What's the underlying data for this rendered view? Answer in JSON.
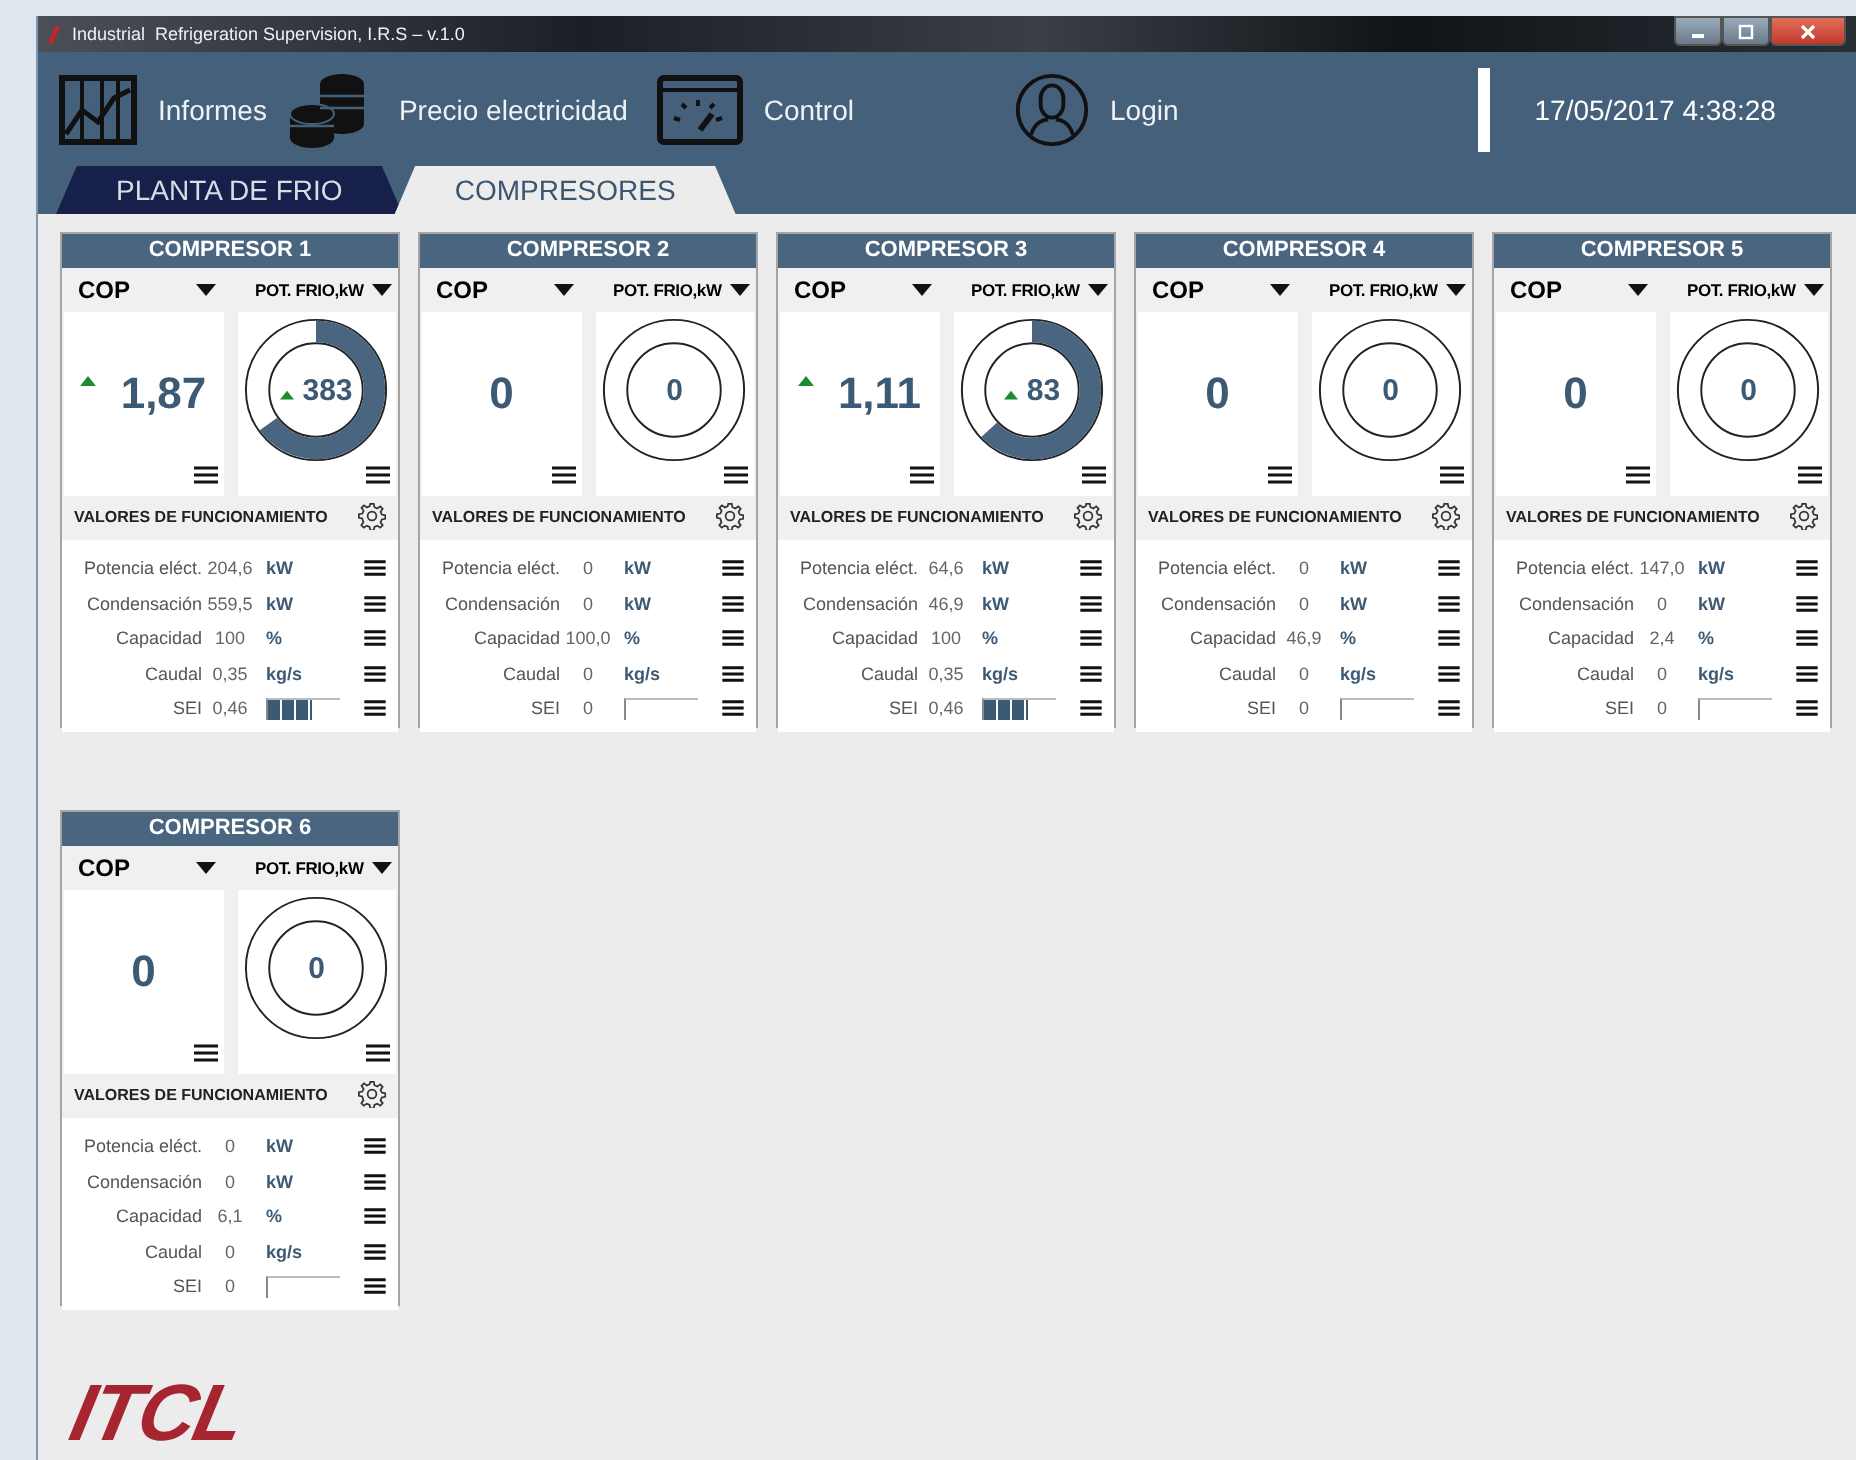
{
  "window": {
    "title": "Industrial  Refrigeration Supervision, I.R.S – v.1.0"
  },
  "toolbar": [
    {
      "label": "Informes",
      "kind": "chart"
    },
    {
      "label": "Precio electricidad",
      "kind": "coins"
    },
    {
      "label": "Control",
      "kind": "gauge"
    }
  ],
  "login": {
    "label": "Login"
  },
  "datetime": "17/05/2017 4:38:28",
  "tabs": [
    {
      "label": "PLANTA DE FRIO",
      "selected": false
    },
    {
      "label": "COMPRESORES",
      "selected": true
    }
  ],
  "compressors": [
    {
      "title": "COMPRESOR 1",
      "cop_label": "COP",
      "pot_label": "POT. FRIO,kW",
      "cop": "1,87",
      "cop_up": true,
      "pot": "383",
      "pot_up": true,
      "level": 0.65,
      "section": "VALORES DE FUNCIONAMIENTO",
      "rows": [
        {
          "kind": "value",
          "label": "Potencia eléct.",
          "value": "204,6",
          "unit": "kW"
        },
        {
          "kind": "value",
          "label": "Condensación",
          "value": "559,5",
          "unit": "kW"
        },
        {
          "kind": "value",
          "label": "Capacidad",
          "value": "100",
          "unit": "%"
        },
        {
          "kind": "value",
          "label": "Caudal",
          "value": "0,35",
          "unit": "kg/s"
        },
        {
          "kind": "bar",
          "label": "SEI",
          "value": "0,46",
          "level": 0.6
        }
      ]
    },
    {
      "title": "COMPRESOR 2",
      "cop_label": "COP",
      "pot_label": "POT. FRIO,kW",
      "cop": "0",
      "cop_up": false,
      "pot": "0",
      "pot_up": false,
      "section": "VALORES DE FUNCIONAMIENTO",
      "rows": [
        {
          "kind": "value",
          "label": "Potencia eléct.",
          "value": "0",
          "unit": "kW"
        },
        {
          "kind": "value",
          "label": "Condensación",
          "value": "0",
          "unit": "kW"
        },
        {
          "kind": "value",
          "label": "Capacidad",
          "value": "100,0",
          "unit": "%"
        },
        {
          "kind": "value",
          "label": "Caudal",
          "value": "0",
          "unit": "kg/s"
        },
        {
          "kind": "bar",
          "label": "SEI",
          "value": "0"
        }
      ]
    },
    {
      "title": "COMPRESOR 3",
      "cop_label": "COP",
      "pot_label": "POT. FRIO,kW",
      "cop": "1,11",
      "cop_up": true,
      "pot": "83",
      "pot_up": true,
      "level": 0.63,
      "section": "VALORES DE FUNCIONAMIENTO",
      "rows": [
        {
          "kind": "value",
          "label": "Potencia eléct.",
          "value": "64,6",
          "unit": "kW"
        },
        {
          "kind": "value",
          "label": "Condensación",
          "value": "46,9",
          "unit": "kW"
        },
        {
          "kind": "value",
          "label": "Capacidad",
          "value": "100",
          "unit": "%"
        },
        {
          "kind": "value",
          "label": "Caudal",
          "value": "0,35",
          "unit": "kg/s"
        },
        {
          "kind": "bar",
          "label": "SEI",
          "value": "0,46",
          "level": 0.6
        }
      ]
    },
    {
      "title": "COMPRESOR 4",
      "cop_label": "COP",
      "pot_label": "POT. FRIO,kW",
      "cop": "0",
      "cop_up": false,
      "pot": "0",
      "pot_up": false,
      "section": "VALORES DE FUNCIONAMIENTO",
      "rows": [
        {
          "kind": "value",
          "label": "Potencia eléct.",
          "value": "0",
          "unit": "kW"
        },
        {
          "kind": "value",
          "label": "Condensación",
          "value": "0",
          "unit": "kW"
        },
        {
          "kind": "value",
          "label": "Capacidad",
          "value": "46,9",
          "unit": "%"
        },
        {
          "kind": "value",
          "label": "Caudal",
          "value": "0",
          "unit": "kg/s"
        },
        {
          "kind": "bar",
          "label": "SEI",
          "value": "0"
        }
      ]
    },
    {
      "title": "COMPRESOR 5",
      "cop_label": "COP",
      "pot_label": "POT. FRIO,kW",
      "cop": "0",
      "cop_up": false,
      "pot": "0",
      "pot_up": false,
      "section": "VALORES DE FUNCIONAMIENTO",
      "rows": [
        {
          "kind": "value",
          "label": "Potencia eléct.",
          "value": "147,0",
          "unit": "kW"
        },
        {
          "kind": "value",
          "label": "Condensación",
          "value": "0",
          "unit": "kW"
        },
        {
          "kind": "value",
          "label": "Capacidad",
          "value": "2,4",
          "unit": "%"
        },
        {
          "kind": "value",
          "label": "Caudal",
          "value": "0",
          "unit": "kg/s"
        },
        {
          "kind": "bar",
          "label": "SEI",
          "value": "0"
        }
      ]
    },
    {
      "title": "COMPRESOR 6",
      "cop_label": "COP",
      "pot_label": "POT. FRIO,kW",
      "cop": "0",
      "cop_up": false,
      "pot": "0",
      "pot_up": false,
      "section": "VALORES DE FUNCIONAMIENTO",
      "rows": [
        {
          "kind": "value",
          "label": "Potencia eléct.",
          "value": "0",
          "unit": "kW"
        },
        {
          "kind": "value",
          "label": "Condensación",
          "value": "0",
          "unit": "kW"
        },
        {
          "kind": "value",
          "label": "Capacidad",
          "value": "6,1",
          "unit": "%"
        },
        {
          "kind": "value",
          "label": "Caudal",
          "value": "0",
          "unit": "kg/s"
        },
        {
          "kind": "bar",
          "label": "SEI",
          "value": "0"
        }
      ]
    }
  ],
  "logo": "ITCL"
}
